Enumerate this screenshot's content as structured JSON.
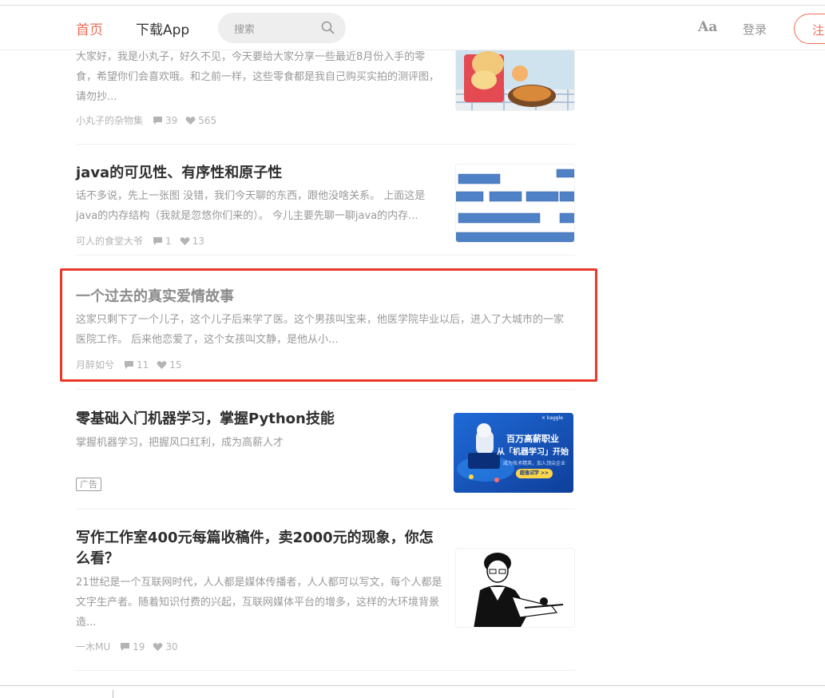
{
  "navbar": {
    "home_label": "首页",
    "app_label": "下载App",
    "search_placeholder": "搜索",
    "font_label": "Aa",
    "login_label": "登录",
    "signup_label": "注"
  },
  "articles": [
    {
      "title": "",
      "abstract": "大家好，我是小丸子，好久不见，今天要给大家分享一些最近8月份入手的零食，希望你们会喜欢哦。和之前一样，这些零食都是我自己购买实拍的测评图，请勿抄...",
      "author": "小丸子的杂物集",
      "comments": "39",
      "likes": "565"
    },
    {
      "title": "java的可见性、有序性和原子性",
      "abstract": "话不多说，先上一张图 没错，我们今天聊的东西，跟他没啥关系。 上面这是java的内存结构（我就是忽悠你们来的）。 今儿主要先聊一聊java的内存...",
      "author": "可人的食堂大爷",
      "comments": "1",
      "likes": "13"
    },
    {
      "title": "一个过去的真实爱情故事",
      "abstract": "这家只剩下了一个儿子，这个儿子后来学了医。这个男孩叫宝来，他医学院毕业以后，进入了大城市的一家医院工作。 后来他恋爱了，这个女孩叫文静，是他从小...",
      "author": "月醉如兮",
      "comments": "11",
      "likes": "15"
    },
    {
      "title": "零基础入门机器学习，掌握Python技能",
      "abstract": "掌握机器学习，把握风口红利，成为高薪人才",
      "ad_label": "广告",
      "ad_banner": {
        "headline1": "百万高薪职业",
        "headline2": "从「机器学习」开始",
        "sub": "成为技术精英，加入顶尖企业",
        "cta": "超值试学 >>",
        "partner": "× kaggle"
      }
    },
    {
      "title": "写作工作室400元每篇收稿件，卖2000元的现象，你怎么看？",
      "abstract": "21世纪是一个互联网时代，人人都是媒体传播者，人人都可以写文，每个人都是文字生产者。随着知识付费的兴起，互联网媒体平台的增多，这样的大环境背景造...",
      "author": "一木MU",
      "comments": "19",
      "likes": "30"
    }
  ],
  "colors": {
    "accent": "#ea6f5a",
    "highlight_border": "#e8392a",
    "ad_blue": "#1a5fc8"
  }
}
